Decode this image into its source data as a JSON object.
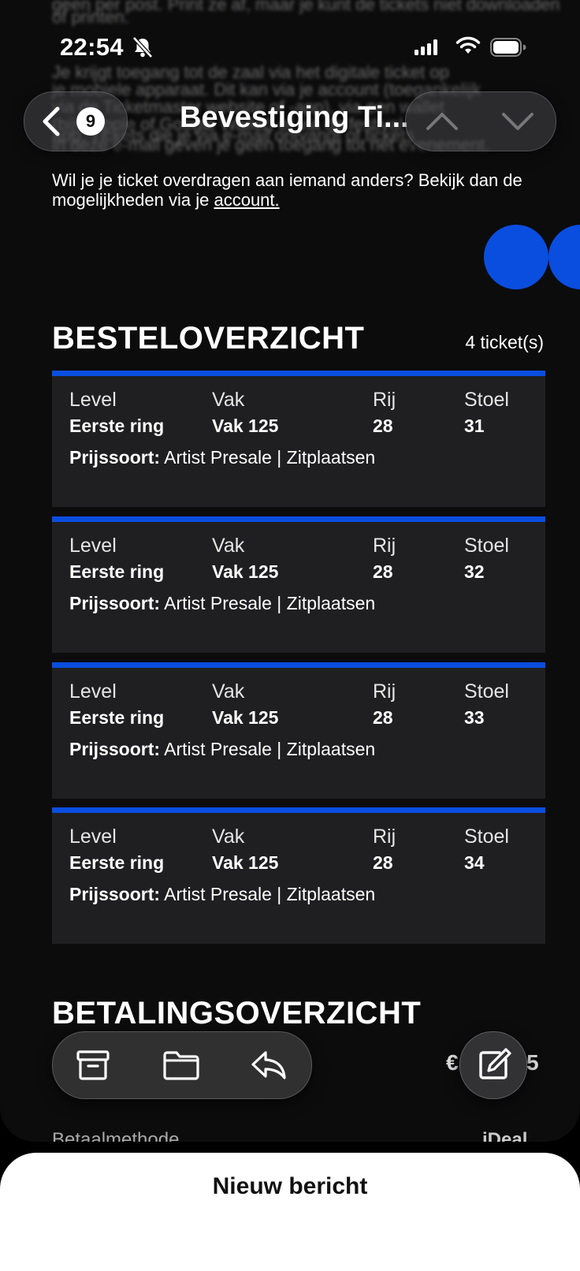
{
  "status": {
    "time": "22:54"
  },
  "background_text": [
    "geen per post. Print ze af, maar je kunt de tickets niet downloaden",
    "of printen.",
    "Je krijgt toegang tot de zaal via het digitale ticket op",
    "je mobiele apparaat. Dit kan via je account (toegankelijk",
    "via de Ticketmaster website of -app), via een wallet",
    "(bijv. Apple of Google Wallet) of via de festival",
    "app. Tickets die je via e-mail ontvangt of tickets",
    "in deze e-mail geven je geen toegang tot het evenement."
  ],
  "nav": {
    "back_badge": "9",
    "title": "Bevestiging Ti..."
  },
  "transfer": {
    "text": "Wil je je ticket overdragen aan iemand anders? Bekijk dan de mogelijkheden via je ",
    "link": "account."
  },
  "order": {
    "title": "BESTELOVERZICHT",
    "count": "4 ticket(s)",
    "labels": {
      "level": "Level",
      "section": "Vak",
      "row": "Rij",
      "seat": "Stoel",
      "price_type": "Prijssoort:"
    },
    "tickets": [
      {
        "level": "Eerste ring",
        "section": "Vak 125",
        "row": "28",
        "seat": "31",
        "price": "Artist Presale | Zitplaatsen"
      },
      {
        "level": "Eerste ring",
        "section": "Vak 125",
        "row": "28",
        "seat": "32",
        "price": "Artist Presale | Zitplaatsen"
      },
      {
        "level": "Eerste ring",
        "section": "Vak 125",
        "row": "28",
        "seat": "33",
        "price": "Artist Presale | Zitplaatsen"
      },
      {
        "level": "Eerste ring",
        "section": "Vak 125",
        "row": "28",
        "seat": "34",
        "price": "Artist Presale | Zitplaatsen"
      }
    ]
  },
  "payment": {
    "title": "BETALINGSOVERZICHT",
    "amount_peek_start": "€",
    "amount_peek_end": "5",
    "method_label": "Betaalmethode",
    "method_value": "iDeal"
  },
  "sheet": {
    "title": "Nieuw bericht"
  },
  "colors": {
    "accent": "#0a4ee0",
    "card": "#1f1f21",
    "background": "#0c0c0d"
  }
}
